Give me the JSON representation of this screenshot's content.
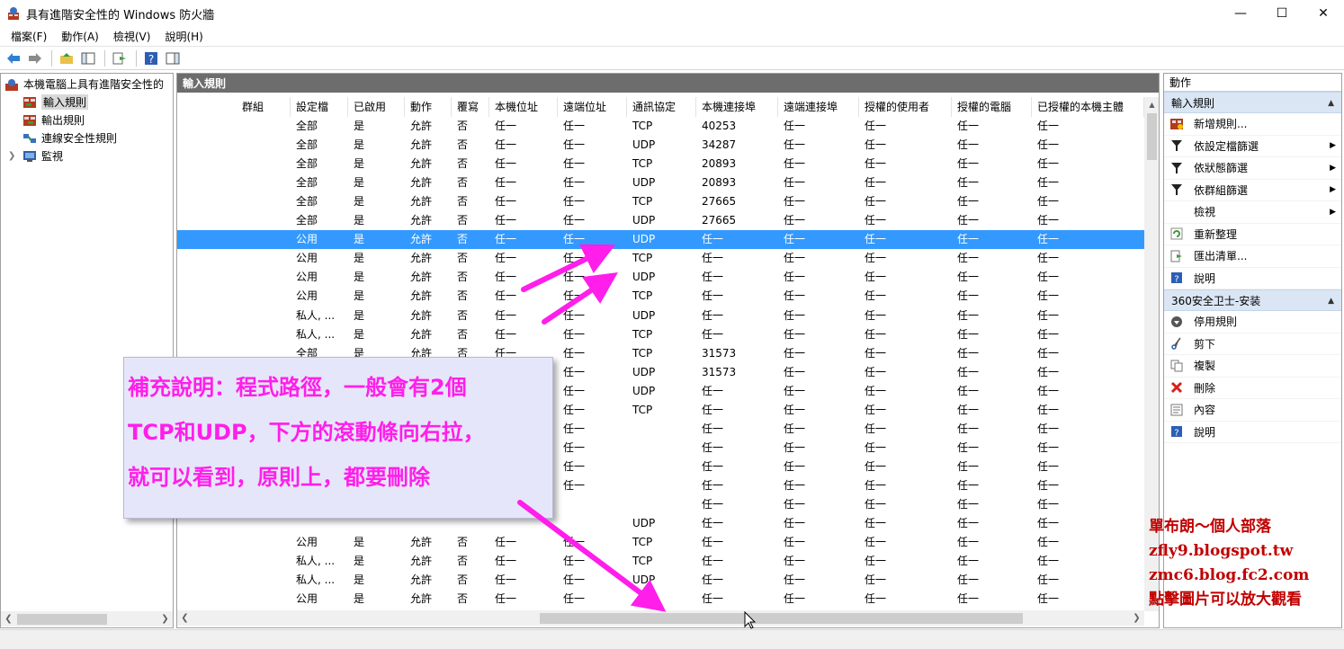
{
  "window": {
    "title": "具有進階安全性的 Windows 防火牆",
    "minimize": "—",
    "maximize": "☐",
    "close": "✕"
  },
  "menu": [
    "檔案(F)",
    "動作(A)",
    "檢視(V)",
    "說明(H)"
  ],
  "tree": {
    "root": "本機電腦上具有進階安全性的",
    "items": [
      "輸入規則",
      "輸出規則",
      "連線安全性規則",
      "監視"
    ]
  },
  "middle": {
    "header": "輸入規則",
    "columns": [
      "群組",
      "設定檔",
      "已啟用",
      "動作",
      "覆寫",
      "本機位址",
      "遠端位址",
      "通訊協定",
      "本機連接埠",
      "遠端連接埠",
      "授權的使用者",
      "授權的電腦",
      "已授權的本機主體"
    ],
    "rows": [
      [
        "",
        "全部",
        "是",
        "允許",
        "否",
        "任一",
        "任一",
        "TCP",
        "40253",
        "任一",
        "任一",
        "任一",
        "任一"
      ],
      [
        "",
        "全部",
        "是",
        "允許",
        "否",
        "任一",
        "任一",
        "UDP",
        "34287",
        "任一",
        "任一",
        "任一",
        "任一"
      ],
      [
        "",
        "全部",
        "是",
        "允許",
        "否",
        "任一",
        "任一",
        "TCP",
        "20893",
        "任一",
        "任一",
        "任一",
        "任一"
      ],
      [
        "",
        "全部",
        "是",
        "允許",
        "否",
        "任一",
        "任一",
        "UDP",
        "20893",
        "任一",
        "任一",
        "任一",
        "任一"
      ],
      [
        "",
        "全部",
        "是",
        "允許",
        "否",
        "任一",
        "任一",
        "TCP",
        "27665",
        "任一",
        "任一",
        "任一",
        "任一"
      ],
      [
        "",
        "全部",
        "是",
        "允許",
        "否",
        "任一",
        "任一",
        "UDP",
        "27665",
        "任一",
        "任一",
        "任一",
        "任一"
      ],
      [
        "",
        "公用",
        "是",
        "允許",
        "否",
        "任一",
        "任一",
        "UDP",
        "任一",
        "任一",
        "任一",
        "任一",
        "任一"
      ],
      [
        "",
        "公用",
        "是",
        "允許",
        "否",
        "任一",
        "任一",
        "TCP",
        "任一",
        "任一",
        "任一",
        "任一",
        "任一"
      ],
      [
        "",
        "公用",
        "是",
        "允許",
        "否",
        "任一",
        "任一",
        "UDP",
        "任一",
        "任一",
        "任一",
        "任一",
        "任一"
      ],
      [
        "",
        "公用",
        "是",
        "允許",
        "否",
        "任一",
        "任一",
        "TCP",
        "任一",
        "任一",
        "任一",
        "任一",
        "任一"
      ],
      [
        "",
        "私人, ...",
        "是",
        "允許",
        "否",
        "任一",
        "任一",
        "UDP",
        "任一",
        "任一",
        "任一",
        "任一",
        "任一"
      ],
      [
        "",
        "私人, ...",
        "是",
        "允許",
        "否",
        "任一",
        "任一",
        "TCP",
        "任一",
        "任一",
        "任一",
        "任一",
        "任一"
      ],
      [
        "",
        "全部",
        "是",
        "允許",
        "否",
        "任一",
        "任一",
        "TCP",
        "31573",
        "任一",
        "任一",
        "任一",
        "任一"
      ],
      [
        "",
        "",
        "",
        "",
        "",
        "",
        "任一",
        "UDP",
        "31573",
        "任一",
        "任一",
        "任一",
        "任一"
      ],
      [
        "",
        "",
        "",
        "",
        "",
        "",
        "任一",
        "UDP",
        "任一",
        "任一",
        "任一",
        "任一",
        "任一"
      ],
      [
        "",
        "",
        "",
        "",
        "",
        "",
        "任一",
        "TCP",
        "任一",
        "任一",
        "任一",
        "任一",
        "任一"
      ],
      [
        "",
        "",
        "",
        "",
        "",
        "",
        "任一",
        "",
        "任一",
        "任一",
        "任一",
        "任一",
        "任一"
      ],
      [
        "",
        "",
        "",
        "",
        "",
        "",
        "任一",
        "",
        "任一",
        "任一",
        "任一",
        "任一",
        "任一"
      ],
      [
        "",
        "",
        "",
        "",
        "",
        "",
        "任一",
        "",
        "任一",
        "任一",
        "任一",
        "任一",
        "任一"
      ],
      [
        "",
        "",
        "",
        "",
        "",
        "",
        "任一",
        "",
        "任一",
        "任一",
        "任一",
        "任一",
        "任一"
      ],
      [
        "",
        "",
        "",
        "",
        "",
        "",
        "",
        "",
        "任一",
        "任一",
        "任一",
        "任一",
        "任一"
      ],
      [
        "",
        "",
        "",
        "",
        "",
        "",
        "",
        "UDP",
        "任一",
        "任一",
        "任一",
        "任一",
        "任一"
      ],
      [
        "",
        "公用",
        "是",
        "允許",
        "否",
        "任一",
        "任一",
        "TCP",
        "任一",
        "任一",
        "任一",
        "任一",
        "任一"
      ],
      [
        "",
        "私人, ...",
        "是",
        "允許",
        "否",
        "任一",
        "任一",
        "TCP",
        "任一",
        "任一",
        "任一",
        "任一",
        "任一"
      ],
      [
        "",
        "私人, ...",
        "是",
        "允許",
        "否",
        "任一",
        "任一",
        "UDP",
        "任一",
        "任一",
        "任一",
        "任一",
        "任一"
      ],
      [
        "",
        "公用",
        "是",
        "允許",
        "否",
        "任一",
        "任一",
        "",
        "任一",
        "任一",
        "任一",
        "任一",
        "任一"
      ]
    ],
    "selected_row": 6
  },
  "actions": {
    "title": "動作",
    "section1": "輸入規則",
    "items1": [
      {
        "label": "新增規則...",
        "icon": "new-rule-icon",
        "submenu": false
      },
      {
        "label": "依設定檔篩選",
        "icon": "filter-icon",
        "submenu": true
      },
      {
        "label": "依狀態篩選",
        "icon": "filter-icon",
        "submenu": true
      },
      {
        "label": "依群組篩選",
        "icon": "filter-icon",
        "submenu": true
      },
      {
        "label": "檢視",
        "icon": "",
        "submenu": true
      },
      {
        "label": "重新整理",
        "icon": "refresh-icon",
        "submenu": false
      },
      {
        "label": "匯出清單...",
        "icon": "export-icon",
        "submenu": false
      },
      {
        "label": "說明",
        "icon": "help-icon",
        "submenu": false
      }
    ],
    "section2": "360安全卫士-安装",
    "items2": [
      {
        "label": "停用規則",
        "icon": "disable-rule-icon"
      },
      {
        "label": "剪下",
        "icon": "cut-icon"
      },
      {
        "label": "複製",
        "icon": "copy-icon"
      },
      {
        "label": "刪除",
        "icon": "delete-icon"
      },
      {
        "label": "內容",
        "icon": "properties-icon"
      },
      {
        "label": "說明",
        "icon": "help-icon"
      }
    ]
  },
  "note": {
    "lines": [
      "補充說明：程式路徑，一般會有2個",
      "TCP和UDP，下方的滾動條向右拉，",
      "就可以看到，原則上，都要刪除"
    ],
    "color": "#ff1eea"
  },
  "watermark": {
    "lines": [
      "單布朗～個人部落",
      "zfly9.blogspot.tw",
      "zmc6.blog.fc2.com",
      "點擊圖片可以放大觀看"
    ],
    "color": "#c00000"
  }
}
